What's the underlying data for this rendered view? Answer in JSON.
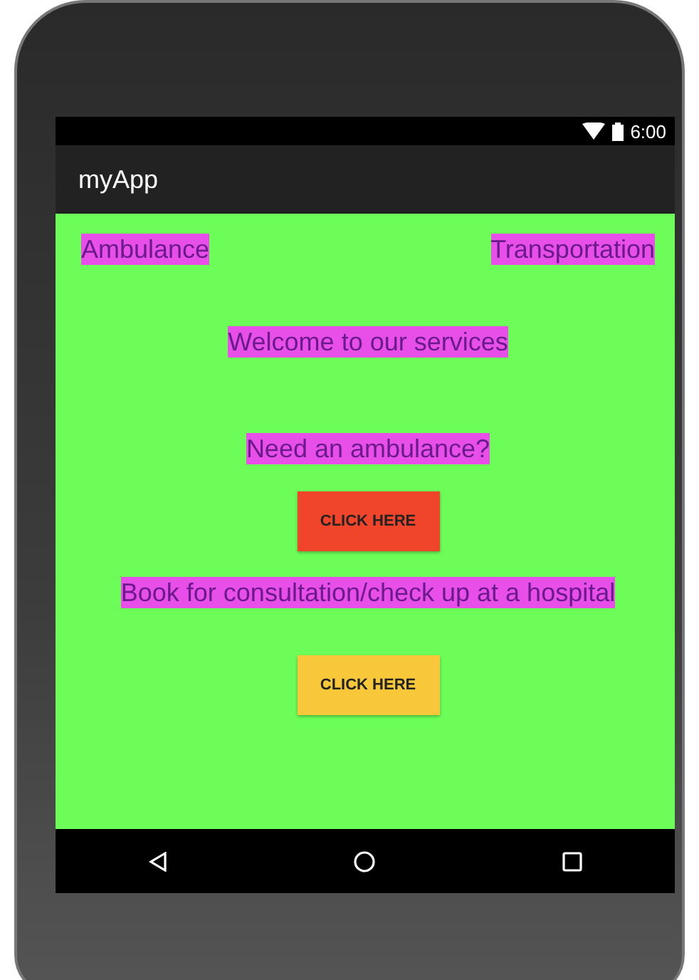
{
  "status_bar": {
    "time": "6:00"
  },
  "app_bar": {
    "title": "myApp"
  },
  "top_links": [
    "Ambulance",
    "Transportation"
  ],
  "welcome": "Welcome to our services",
  "sections": [
    {
      "heading": "Need an ambulance?",
      "button": {
        "label": "CLICK HERE",
        "color": "#f0452a"
      }
    },
    {
      "heading": "Book for consultation/check up at a hospital",
      "button": {
        "label": "CLICK HERE",
        "color": "#f8c73a"
      }
    }
  ]
}
